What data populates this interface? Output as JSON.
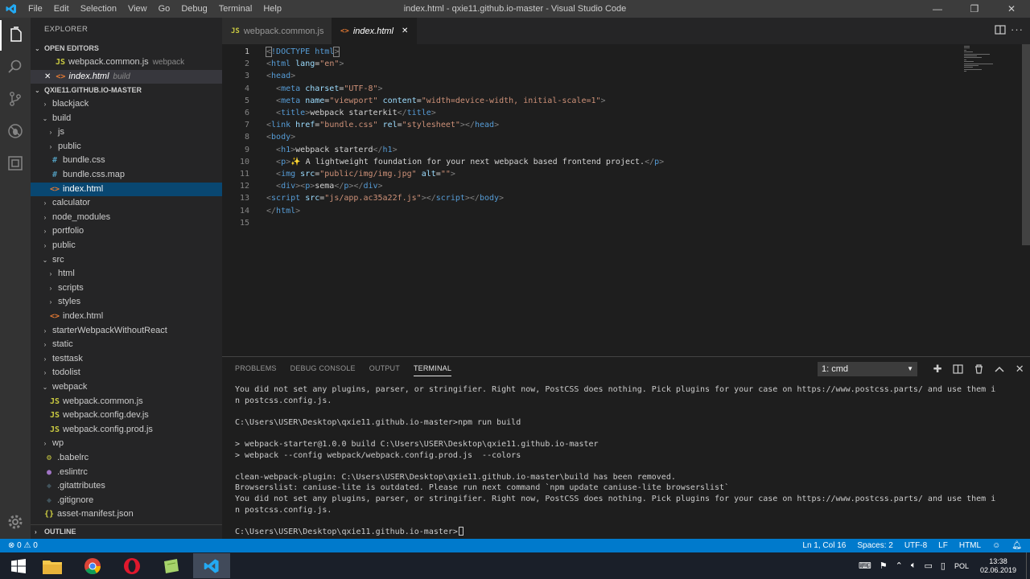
{
  "titlebar": {
    "menu": [
      "File",
      "Edit",
      "Selection",
      "View",
      "Go",
      "Debug",
      "Terminal",
      "Help"
    ],
    "title": "index.html - qxie11.github.io-master - Visual Studio Code",
    "min": "—",
    "max": "❐",
    "close": "✕"
  },
  "sidebar": {
    "header": "EXPLORER",
    "open_editors_label": "OPEN EDITORS",
    "open_editors": [
      {
        "icon": "JS",
        "name": "webpack.common.js",
        "desc": "webpack"
      },
      {
        "icon": "<>",
        "name": "index.html",
        "desc": "build",
        "close": "✕"
      }
    ],
    "project_label": "QXIE11.GITHUB.IO-MASTER",
    "tree": [
      {
        "depth": 0,
        "twist": "›",
        "name": "blackjack"
      },
      {
        "depth": 0,
        "twist": "⌄",
        "name": "build"
      },
      {
        "depth": 1,
        "twist": "›",
        "name": "js"
      },
      {
        "depth": 1,
        "twist": "›",
        "name": "public"
      },
      {
        "depth": 1,
        "icon": "#",
        "name": "bundle.css"
      },
      {
        "depth": 1,
        "icon": "#",
        "name": "bundle.css.map"
      },
      {
        "depth": 1,
        "icon": "<>",
        "name": "index.html",
        "selected": true
      },
      {
        "depth": 0,
        "twist": "›",
        "name": "calculator"
      },
      {
        "depth": 0,
        "twist": "›",
        "name": "node_modules"
      },
      {
        "depth": 0,
        "twist": "›",
        "name": "portfolio"
      },
      {
        "depth": 0,
        "twist": "›",
        "name": "public"
      },
      {
        "depth": 0,
        "twist": "⌄",
        "name": "src"
      },
      {
        "depth": 1,
        "twist": "›",
        "name": "html"
      },
      {
        "depth": 1,
        "twist": "›",
        "name": "scripts"
      },
      {
        "depth": 1,
        "twist": "›",
        "name": "styles"
      },
      {
        "depth": 1,
        "icon": "<>",
        "name": "index.html"
      },
      {
        "depth": 0,
        "twist": "›",
        "name": "starterWebpackWithoutReact"
      },
      {
        "depth": 0,
        "twist": "›",
        "name": "static"
      },
      {
        "depth": 0,
        "twist": "›",
        "name": "testtask"
      },
      {
        "depth": 0,
        "twist": "›",
        "name": "todolist"
      },
      {
        "depth": 0,
        "twist": "⌄",
        "name": "webpack"
      },
      {
        "depth": 1,
        "icon": "JS",
        "name": "webpack.common.js"
      },
      {
        "depth": 1,
        "icon": "JS",
        "name": "webpack.config.dev.js"
      },
      {
        "depth": 1,
        "icon": "JS",
        "name": "webpack.config.prod.js"
      },
      {
        "depth": 0,
        "twist": "›",
        "name": "wp"
      },
      {
        "depth": 0,
        "icon": "⚙",
        "name": ".babelrc"
      },
      {
        "depth": 0,
        "icon": "●",
        "name": ".eslintrc"
      },
      {
        "depth": 0,
        "icon": "◆",
        "name": ".gitattributes"
      },
      {
        "depth": 0,
        "icon": "◆",
        "name": ".gitignore"
      },
      {
        "depth": 0,
        "icon": "{}",
        "name": "asset-manifest.json"
      }
    ],
    "outline_label": "OUTLINE"
  },
  "tabs": [
    {
      "icon": "JS",
      "label": "webpack.common.js",
      "active": false
    },
    {
      "icon": "<>",
      "label": "index.html",
      "active": true,
      "close": "✕"
    }
  ],
  "editor": {
    "lines": [
      [
        [
          "t",
          "<"
        ],
        [
          "tg",
          "!DOCTYPE"
        ],
        [
          "tx",
          " "
        ],
        [
          "tg",
          "html"
        ],
        [
          "t",
          ">"
        ]
      ],
      [
        [
          "t",
          "<"
        ],
        [
          "tg",
          "html"
        ],
        [
          "tx",
          " "
        ],
        [
          "at",
          "lang"
        ],
        [
          "tx",
          "="
        ],
        [
          "st",
          "\"en\""
        ],
        [
          "t",
          ">"
        ]
      ],
      [
        [
          "t",
          "<"
        ],
        [
          "tg",
          "head"
        ],
        [
          "t",
          ">"
        ]
      ],
      [
        [
          "tx",
          "  "
        ],
        [
          "t",
          "<"
        ],
        [
          "tg",
          "meta"
        ],
        [
          "tx",
          " "
        ],
        [
          "at",
          "charset"
        ],
        [
          "tx",
          "="
        ],
        [
          "st",
          "\"UTF-8\""
        ],
        [
          "t",
          ">"
        ]
      ],
      [
        [
          "tx",
          "  "
        ],
        [
          "t",
          "<"
        ],
        [
          "tg",
          "meta"
        ],
        [
          "tx",
          " "
        ],
        [
          "at",
          "name"
        ],
        [
          "tx",
          "="
        ],
        [
          "st",
          "\"viewport\""
        ],
        [
          "tx",
          " "
        ],
        [
          "at",
          "content"
        ],
        [
          "tx",
          "="
        ],
        [
          "st",
          "\"width=device-width, initial-scale=1\""
        ],
        [
          "t",
          ">"
        ]
      ],
      [
        [
          "tx",
          "  "
        ],
        [
          "t",
          "<"
        ],
        [
          "tg",
          "title"
        ],
        [
          "t",
          ">"
        ],
        [
          "tx",
          "webpack starterkit"
        ],
        [
          "t",
          "</"
        ],
        [
          "tg",
          "title"
        ],
        [
          "t",
          ">"
        ]
      ],
      [
        [
          "t",
          "<"
        ],
        [
          "tg",
          "link"
        ],
        [
          "tx",
          " "
        ],
        [
          "at",
          "href"
        ],
        [
          "tx",
          "="
        ],
        [
          "st",
          "\"bundle.css\""
        ],
        [
          "tx",
          " "
        ],
        [
          "at",
          "rel"
        ],
        [
          "tx",
          "="
        ],
        [
          "st",
          "\"stylesheet\""
        ],
        [
          "t",
          "></"
        ],
        [
          "tg",
          "head"
        ],
        [
          "t",
          ">"
        ]
      ],
      [
        [
          "t",
          "<"
        ],
        [
          "tg",
          "body"
        ],
        [
          "t",
          ">"
        ]
      ],
      [
        [
          "tx",
          "  "
        ],
        [
          "t",
          "<"
        ],
        [
          "tg",
          "h1"
        ],
        [
          "t",
          ">"
        ],
        [
          "tx",
          "webpack starterd"
        ],
        [
          "t",
          "</"
        ],
        [
          "tg",
          "h1"
        ],
        [
          "t",
          ">"
        ]
      ],
      [
        [
          "tx",
          "  "
        ],
        [
          "t",
          "<"
        ],
        [
          "tg",
          "p"
        ],
        [
          "t",
          ">"
        ],
        [
          "tx",
          "✨ A lightweight foundation for your next webpack based frontend project."
        ],
        [
          "t",
          "</"
        ],
        [
          "tg",
          "p"
        ],
        [
          "t",
          ">"
        ]
      ],
      [
        [
          "tx",
          "  "
        ],
        [
          "t",
          "<"
        ],
        [
          "tg",
          "img"
        ],
        [
          "tx",
          " "
        ],
        [
          "at",
          "src"
        ],
        [
          "tx",
          "="
        ],
        [
          "st",
          "\"public/img/img.jpg\""
        ],
        [
          "tx",
          " "
        ],
        [
          "at",
          "alt"
        ],
        [
          "tx",
          "="
        ],
        [
          "st",
          "\"\""
        ],
        [
          "t",
          ">"
        ]
      ],
      [
        [
          "tx",
          "  "
        ],
        [
          "t",
          "<"
        ],
        [
          "tg",
          "div"
        ],
        [
          "t",
          "><"
        ],
        [
          "tg",
          "p"
        ],
        [
          "t",
          ">"
        ],
        [
          "tx",
          "sema"
        ],
        [
          "t",
          "</"
        ],
        [
          "tg",
          "p"
        ],
        [
          "t",
          "></"
        ],
        [
          "tg",
          "div"
        ],
        [
          "t",
          ">"
        ]
      ],
      [
        [
          "t",
          "<"
        ],
        [
          "tg",
          "script"
        ],
        [
          "tx",
          " "
        ],
        [
          "at",
          "src"
        ],
        [
          "tx",
          "="
        ],
        [
          "st",
          "\"js/app.ac35a22f.js\""
        ],
        [
          "t",
          "></"
        ],
        [
          "tg",
          "script"
        ],
        [
          "t",
          "></"
        ],
        [
          "tg",
          "body"
        ],
        [
          "t",
          ">"
        ]
      ],
      [
        [
          "t",
          "</"
        ],
        [
          "tg",
          "html"
        ],
        [
          "t",
          ">"
        ]
      ],
      []
    ]
  },
  "panel": {
    "tabs": [
      "PROBLEMS",
      "DEBUG CONSOLE",
      "OUTPUT",
      "TERMINAL"
    ],
    "active_tab": "TERMINAL",
    "terminal_select": "1: cmd",
    "lines": [
      "You did not set any plugins, parser, or stringifier. Right now, PostCSS does nothing. Pick plugins for your case on https://www.postcss.parts/ and use them i",
      "n postcss.config.js.",
      "",
      "C:\\Users\\USER\\Desktop\\qxie11.github.io-master>npm run build",
      "",
      "> webpack-starter@1.0.0 build C:\\Users\\USER\\Desktop\\qxie11.github.io-master",
      "> webpack --config webpack/webpack.config.prod.js  --colors",
      "",
      "clean-webpack-plugin: C:\\Users\\USER\\Desktop\\qxie11.github.io-master\\build has been removed.",
      "Browserslist: caniuse-lite is outdated. Please run next command `npm update caniuse-lite browserslist`",
      "You did not set any plugins, parser, or stringifier. Right now, PostCSS does nothing. Pick plugins for your case on https://www.postcss.parts/ and use them i",
      "n postcss.config.js.",
      "",
      "C:\\Users\\USER\\Desktop\\qxie11.github.io-master>"
    ]
  },
  "statusbar": {
    "errors": "0",
    "warnings": "0",
    "position": "Ln 1, Col 16",
    "spaces": "Spaces: 2",
    "encoding": "UTF-8",
    "eol": "LF",
    "language": "HTML"
  },
  "taskbar": {
    "lang": "POL",
    "time": "13:38",
    "date": "02.06.2019"
  }
}
